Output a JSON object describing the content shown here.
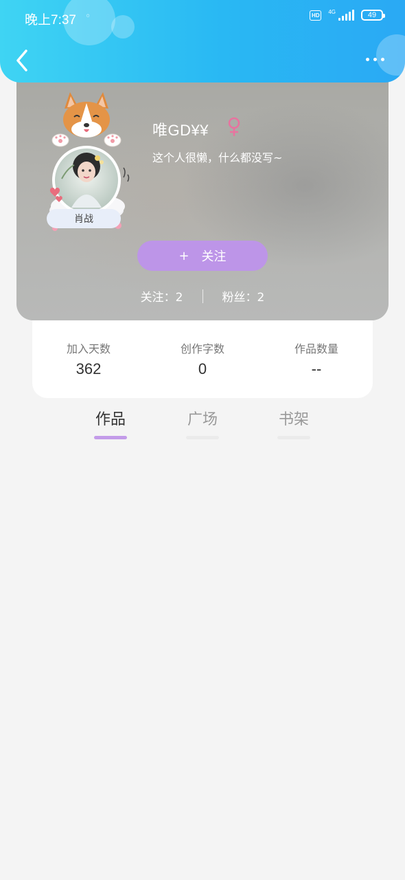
{
  "status_bar": {
    "time": "晚上7:37",
    "hd": "HD",
    "network": "4G",
    "battery": "49"
  },
  "profile": {
    "username": "唯GD¥¥",
    "bio": "这个人很懒，什么都没写~",
    "tag": "肖战",
    "follow_label": "关注",
    "following": "关注：2",
    "followers": "粉丝：2"
  },
  "stats": [
    {
      "label": "加入天数",
      "value": "362"
    },
    {
      "label": "创作字数",
      "value": "0"
    },
    {
      "label": "作品数量",
      "value": "--"
    }
  ],
  "tabs": [
    {
      "label": "作品",
      "active": true
    },
    {
      "label": "广场",
      "active": false
    },
    {
      "label": "书架",
      "active": false
    }
  ],
  "colors": {
    "header_gradient_start": "#3fd4f3",
    "header_gradient_end": "#2aa9f4",
    "follow_button": "#bd95e8",
    "tab_active_underline": "#c39be9",
    "gender_icon": "#e8739f"
  }
}
